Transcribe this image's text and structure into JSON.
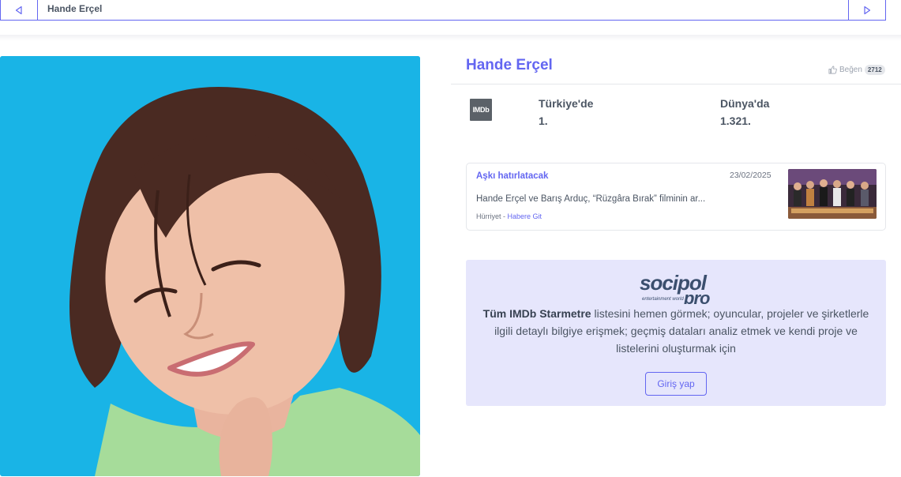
{
  "nav": {
    "prev_icon": "triangle-left-icon",
    "next_icon": "triangle-right-icon",
    "title": "Hande Erçel"
  },
  "profile": {
    "name": "Hande Erçel",
    "like_label": "Beğen",
    "like_count": "2712",
    "photo_alt": "Hande Erçel"
  },
  "ranking": {
    "source_logo": "IMDb",
    "turkey_label": "Türkiye'de",
    "turkey_value": "1.",
    "world_label": "Dünya'da",
    "world_value": "1.321."
  },
  "news": {
    "title": "Aşkı hatırlatacak",
    "date": "23/02/2025",
    "snippet": "Hande Erçel ve Barış Arduç, “Rüzgâra Bırak” filminin ar...",
    "source": "Hürriyet",
    "separator": " - ",
    "link_label": "Habere Git"
  },
  "promo": {
    "logo_main": "socipol",
    "logo_sub": "pro",
    "logo_tagline": "entertainment world",
    "text_bold": "Tüm IMDb Starmetre",
    "text_rest": " listesini hemen görmek; oyuncular, projeler ve şirketlerle ilgili detaylı bilgiye erişmek; geçmiş dataları analiz etmek ve kendi proje ve listelerini oluşturmak için",
    "button_label": "Giriş yap"
  },
  "colors": {
    "accent": "#6366f1",
    "promo_bg": "#e6e6fc",
    "photo_bg": "#19b4e6"
  }
}
